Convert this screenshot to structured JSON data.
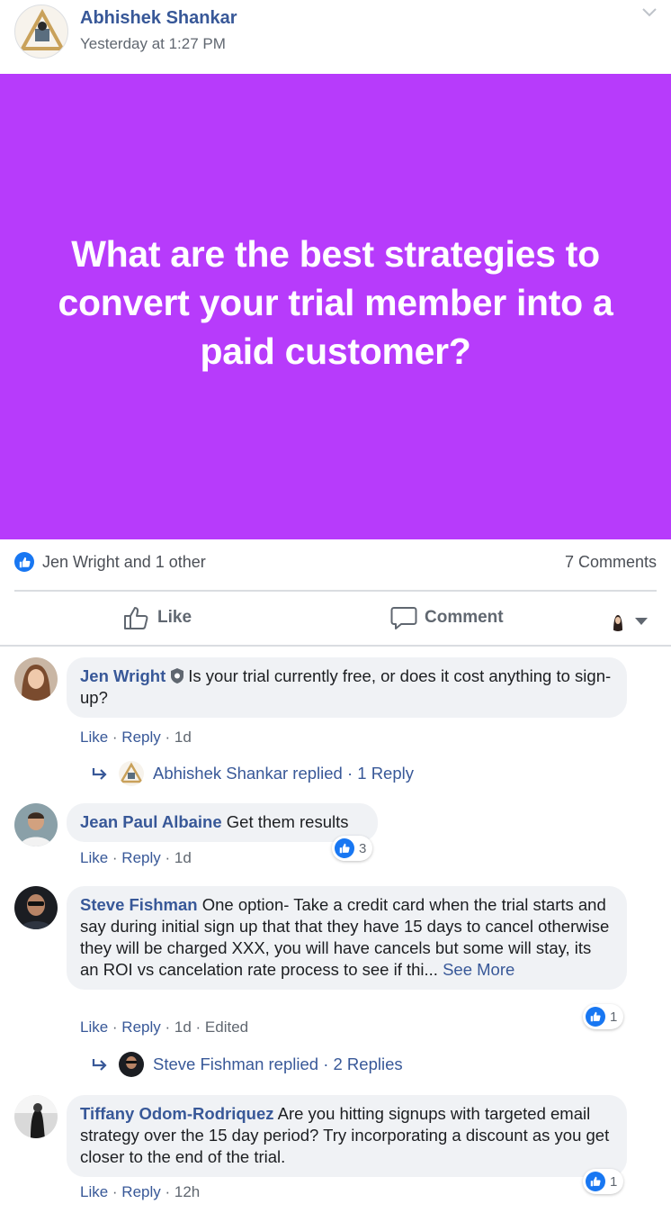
{
  "post": {
    "author": "Abhishek Shankar",
    "timestamp": "Yesterday at 1:27 PM",
    "banner_text": "What are the best strategies to convert your trial member into a paid customer?",
    "banner_color": "#b73bfb"
  },
  "reactions": {
    "summary": "Jen Wright and 1 other",
    "comments_count": "7 Comments"
  },
  "actions": {
    "like_label": "Like",
    "comment_label": "Comment"
  },
  "comments": [
    {
      "author": "Jen Wright",
      "text": "Is your trial currently free, or does it cost anything to sign-up?",
      "like": "Like",
      "reply": "Reply",
      "age": "1d",
      "replies_text": "Abhishek Shankar replied · 1 Reply"
    },
    {
      "author": "Jean Paul Albaine",
      "text": "Get them results",
      "like": "Like",
      "reply": "Reply",
      "age": "1d",
      "reaction_count": "3"
    },
    {
      "author": "Steve Fishman",
      "text": "One option- Take a credit card when the trial starts and say during initial sign up that that they have 15 days to cancel otherwise they will be charged XXX, you will have cancels but some will stay, its an ROI vs cancelation rate process to see if thi...",
      "see_more": "See More",
      "like": "Like",
      "reply": "Reply",
      "age": "1d",
      "edited": "Edited",
      "reaction_count": "1",
      "replies_text": "Steve Fishman replied · 2 Replies"
    },
    {
      "author": "Tiffany Odom-Rodriquez",
      "text": "Are you hitting signups with targeted email strategy over the 15 day period? Try incorporating a discount as you get closer to the end of the trial.",
      "like": "Like",
      "reply": "Reply",
      "age": "12h",
      "reaction_count": "1"
    }
  ],
  "colors": {
    "link": "#385898",
    "like_blue": "#1877f2",
    "bubble": "#f0f2f5",
    "muted": "#606770"
  }
}
